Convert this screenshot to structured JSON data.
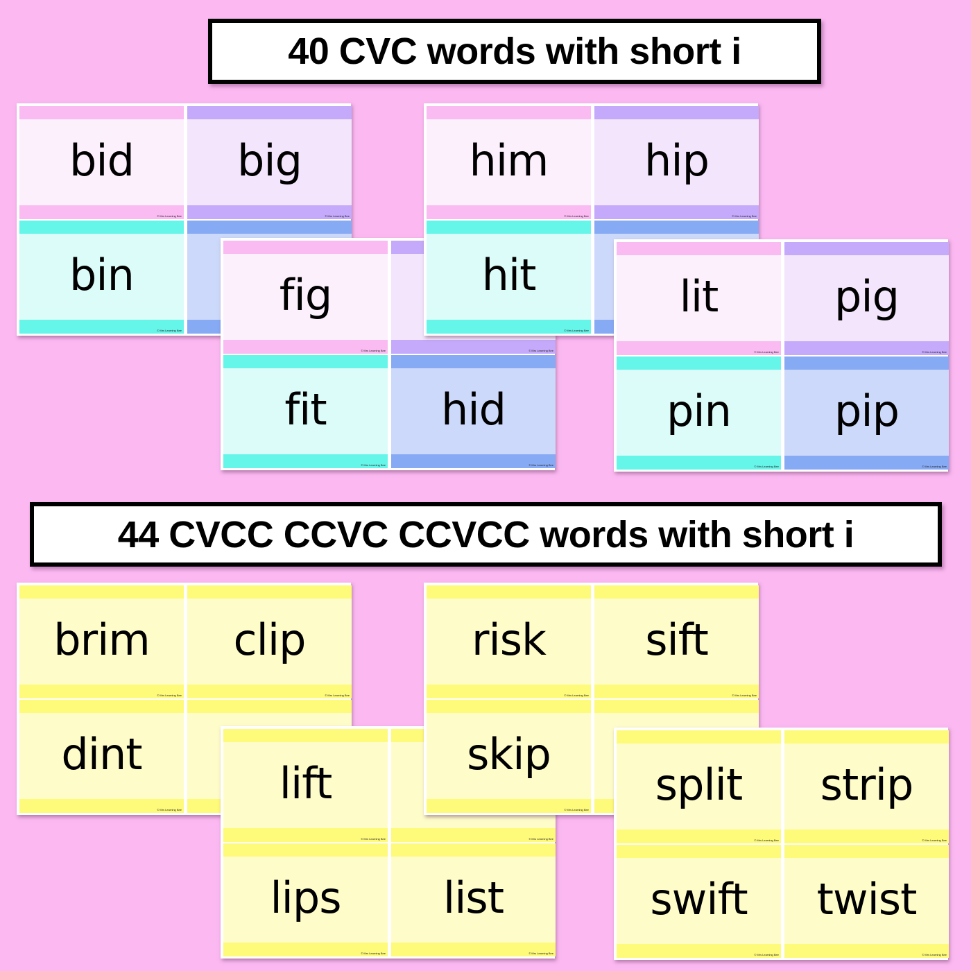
{
  "banners": {
    "cvc_title": "40 CVC words with short i",
    "blends_title": "44 CVCC CCVC CCVCC words with short i"
  },
  "credit": "© Mrs Learning Bee",
  "theme_colors": {
    "background": "#fbb8f1",
    "pink": {
      "fill": "#fdf0fd",
      "band": "#f9bbf1"
    },
    "purple": {
      "fill": "#f3e5fc",
      "band": "#c5a9fa"
    },
    "teal": {
      "fill": "#dbfcf9",
      "band": "#66f5e9"
    },
    "blue": {
      "fill": "#cdd9fa",
      "band": "#87aaf5"
    },
    "yellow": {
      "fill": "#fefdc9",
      "band": "#fefa7a"
    }
  },
  "sheets": {
    "a": {
      "words": [
        "bid",
        "big",
        "bin",
        ""
      ]
    },
    "b": {
      "words": [
        "fig",
        "",
        "fit",
        "hid"
      ]
    },
    "c": {
      "words": [
        "him",
        "hip",
        "hit",
        ""
      ]
    },
    "d": {
      "words": [
        "lit",
        "pig",
        "pin",
        "pip"
      ]
    },
    "e": {
      "words": [
        "brim",
        "clip",
        "dint",
        ""
      ]
    },
    "f": {
      "words": [
        "lift",
        "",
        "lips",
        "list"
      ]
    },
    "g": {
      "words": [
        "risk",
        "sift",
        "skip",
        ""
      ]
    },
    "h": {
      "words": [
        "split",
        "strip",
        "swift",
        "twist"
      ]
    }
  }
}
